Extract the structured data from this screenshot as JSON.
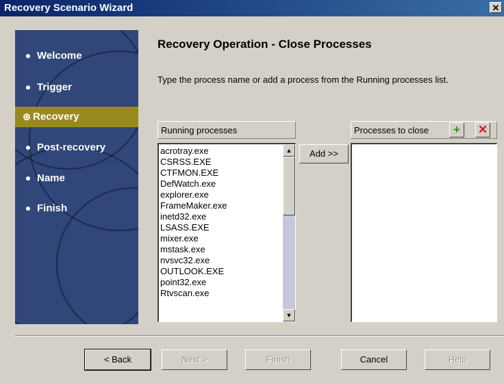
{
  "window": {
    "title": "Recovery Scenario Wizard",
    "close_glyph": "✕"
  },
  "sidebar": {
    "items": [
      {
        "label": "Welcome",
        "active": false
      },
      {
        "label": "Trigger",
        "active": false
      },
      {
        "label": "Recovery",
        "active": true
      },
      {
        "label": "Post-recovery",
        "active": false
      },
      {
        "label": "Name",
        "active": false
      },
      {
        "label": "Finish",
        "active": false
      }
    ]
  },
  "main": {
    "heading": "Recovery Operation - Close Processes",
    "description": "Type the process name or add a process from the Running processes list."
  },
  "running": {
    "header": "Running processes",
    "items": [
      "acrotray.exe",
      "CSRSS.EXE",
      "CTFMON.EXE",
      "DefWatch.exe",
      "explorer.exe",
      "FrameMaker.exe",
      "inetd32.exe",
      "LSASS.EXE",
      "mixer.exe",
      "mstask.exe",
      "nvsvc32.exe",
      "OUTLOOK.EXE",
      "point32.exe",
      "Rtvscan.exe"
    ]
  },
  "add_button": "Add >>",
  "to_close": {
    "header": "Processes to close",
    "add_icon": "plus-icon",
    "remove_icon": "x-icon",
    "add_color": "#1a9a1a",
    "remove_color": "#e0102a",
    "items": []
  },
  "footer": {
    "back": "< Back",
    "next": "Next >",
    "finish": "Finish",
    "cancel": "Cancel",
    "help": "Help"
  }
}
